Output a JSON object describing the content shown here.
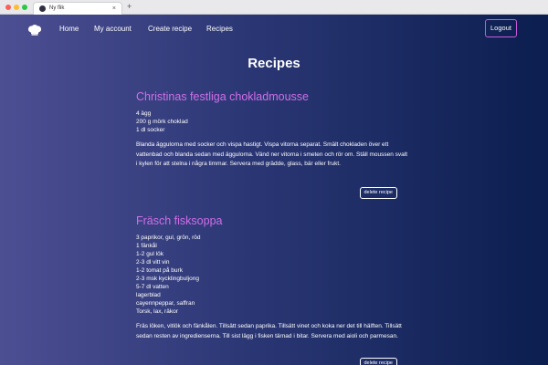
{
  "browser": {
    "tab_title": "Ny flik",
    "tab_close": "×",
    "new_tab": "+"
  },
  "nav": {
    "logo_icon": "chef-hat-icon",
    "links": [
      {
        "label": "Home"
      },
      {
        "label": "My account"
      },
      {
        "label": "Create recipe"
      },
      {
        "label": "Recipes"
      }
    ],
    "logout_label": "Logout",
    "accent_color": "#c75bd9"
  },
  "page": {
    "title": "Recipes"
  },
  "recipes": [
    {
      "name": "Christinas festliga chokladmousse",
      "ingredients": [
        "4 ägg",
        "200 g mörk choklad",
        "1 dl socker"
      ],
      "instructions": "Blanda äggulorna med socker och vispa hastigt. Vispa vitorna separat. Smält chokladen över ett vattenbad och blanda sedan med äggulorna. Vänd ner vitorna i smeten och rör om. Ställ moussen svalt i kylen för att stelna i några timmar. Servera med grädde, glass, bär eller frukt.",
      "delete_label": "delete recipe"
    },
    {
      "name": "Fräsch fisksoppa",
      "ingredients": [
        "3 paprikor, gul, grön, röd",
        "1 fänkål",
        "1-2 gul lök",
        "2-3 dl vitt vin",
        "1-2 tomat på burk",
        "2-3 msk kycklingbuljong",
        "5-7 dl vatten",
        "lagerblad",
        "cayennpeppar, saffran",
        "Torsk, lax, räkor"
      ],
      "instructions": "Fräs löken, vitlök och fänkålen. Tillsätt sedan paprika. Tillsätt vinet och koka ner det till hälften. Tillsätt sedan resten av ingredienserna. Till sist lägg i fisken tärnad i bitar. Servera med aioli och parmesan.",
      "delete_label": "delete recipe"
    }
  ],
  "colors": {
    "recipe_title": "#d16ee8",
    "background_left": "#4d4f93",
    "background_right": "#0b1e4f"
  }
}
